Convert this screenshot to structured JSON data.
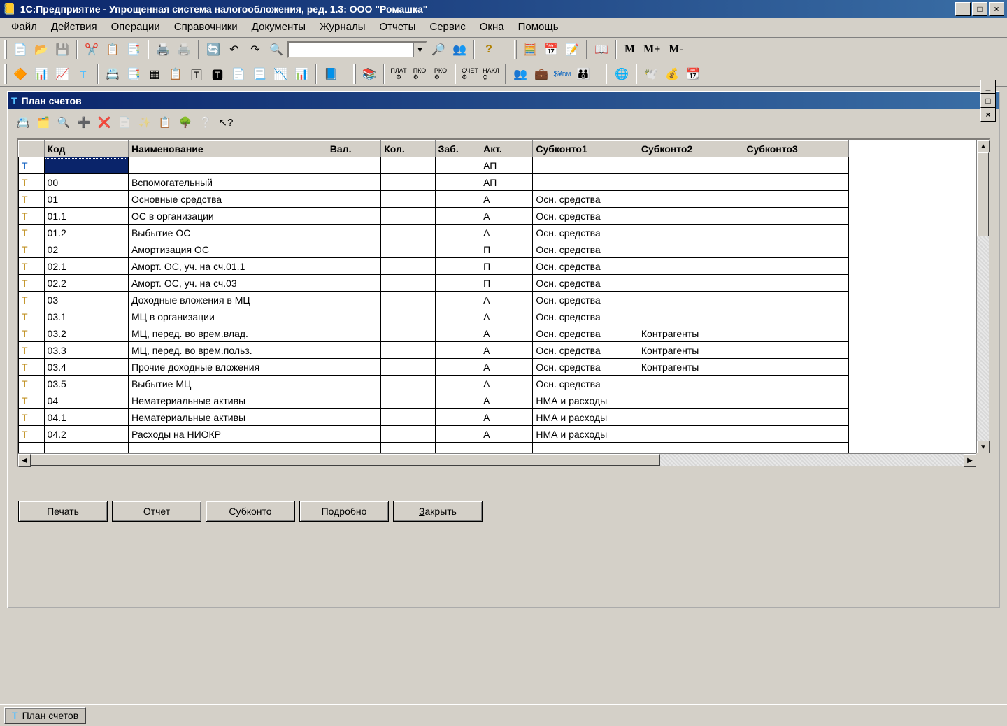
{
  "app": {
    "title": "1С:Предприятие - Упрощенная система налогообложения, ред. 1.3: ООО \"Ромашка\""
  },
  "menu": {
    "items": [
      "Файл",
      "Действия",
      "Операции",
      "Справочники",
      "Документы",
      "Журналы",
      "Отчеты",
      "Сервис",
      "Окна",
      "Помощь"
    ]
  },
  "toolbar1": {
    "search_value": "",
    "m": "M",
    "mplus": "M+",
    "mminus": "M-"
  },
  "inner": {
    "title": "План счетов",
    "buttons": {
      "print": "Печать",
      "report": "Отчет",
      "subkonto": "Субконто",
      "detail": "Подробно",
      "close_u": "З",
      "close_rest": "акрыть"
    }
  },
  "columns": {
    "icon": "",
    "code": "Код",
    "name": "Наименование",
    "val": "Вал.",
    "kol": "Кол.",
    "zab": "Заб.",
    "akt": "Акт.",
    "sub1": "Субконто1",
    "sub2": "Субконто2",
    "sub3": "Субконто3"
  },
  "rows": [
    {
      "icon": "blue",
      "code": "",
      "name": "",
      "val": "",
      "kol": "",
      "zab": "",
      "akt": "АП",
      "sub1": "",
      "sub2": "",
      "sub3": "",
      "selected": true
    },
    {
      "icon": "y",
      "code": "00",
      "name": "Вспомогательный",
      "val": "",
      "kol": "",
      "zab": "",
      "akt": "АП",
      "sub1": "",
      "sub2": "",
      "sub3": ""
    },
    {
      "icon": "y",
      "code": "01",
      "name": "Основные средства",
      "val": "",
      "kol": "",
      "zab": "",
      "akt": "А",
      "sub1": "Осн. средства",
      "sub2": "",
      "sub3": ""
    },
    {
      "icon": "y",
      "code": "01.1",
      "name": "ОС в организации",
      "val": "",
      "kol": "",
      "zab": "",
      "akt": "А",
      "sub1": "Осн. средства",
      "sub2": "",
      "sub3": ""
    },
    {
      "icon": "y",
      "code": "01.2",
      "name": "Выбытие ОС",
      "val": "",
      "kol": "",
      "zab": "",
      "akt": "А",
      "sub1": "Осн. средства",
      "sub2": "",
      "sub3": ""
    },
    {
      "icon": "y",
      "code": "02",
      "name": "Амортизация ОС",
      "val": "",
      "kol": "",
      "zab": "",
      "akt": "П",
      "sub1": "Осн. средства",
      "sub2": "",
      "sub3": ""
    },
    {
      "icon": "y",
      "code": "02.1",
      "name": "Аморт. ОС, уч. на сч.01.1",
      "val": "",
      "kol": "",
      "zab": "",
      "akt": "П",
      "sub1": "Осн. средства",
      "sub2": "",
      "sub3": ""
    },
    {
      "icon": "y",
      "code": "02.2",
      "name": "Аморт. ОС, уч. на сч.03",
      "val": "",
      "kol": "",
      "zab": "",
      "akt": "П",
      "sub1": "Осн. средства",
      "sub2": "",
      "sub3": ""
    },
    {
      "icon": "y",
      "code": "03",
      "name": "Доходные вложения в МЦ",
      "val": "",
      "kol": "",
      "zab": "",
      "akt": "А",
      "sub1": "Осн. средства",
      "sub2": "",
      "sub3": ""
    },
    {
      "icon": "y",
      "code": "03.1",
      "name": "МЦ в организации",
      "val": "",
      "kol": "",
      "zab": "",
      "akt": "А",
      "sub1": "Осн. средства",
      "sub2": "",
      "sub3": ""
    },
    {
      "icon": "y",
      "code": "03.2",
      "name": "МЦ, перед. во врем.влад.",
      "val": "",
      "kol": "",
      "zab": "",
      "akt": "А",
      "sub1": "Осн. средства",
      "sub2": "Контрагенты",
      "sub3": ""
    },
    {
      "icon": "y",
      "code": "03.3",
      "name": "МЦ, перед. во врем.польз.",
      "val": "",
      "kol": "",
      "zab": "",
      "akt": "А",
      "sub1": "Осн. средства",
      "sub2": "Контрагенты",
      "sub3": ""
    },
    {
      "icon": "y",
      "code": "03.4",
      "name": "Прочие доходные вложения",
      "val": "",
      "kol": "",
      "zab": "",
      "akt": "А",
      "sub1": "Осн. средства",
      "sub2": "Контрагенты",
      "sub3": ""
    },
    {
      "icon": "y",
      "code": "03.5",
      "name": "Выбытие МЦ",
      "val": "",
      "kol": "",
      "zab": "",
      "akt": "А",
      "sub1": "Осн. средства",
      "sub2": "",
      "sub3": ""
    },
    {
      "icon": "y",
      "code": "04",
      "name": "Нематериальные активы",
      "val": "",
      "kol": "",
      "zab": "",
      "akt": "А",
      "sub1": "НМА и расходы",
      "sub2": "",
      "sub3": ""
    },
    {
      "icon": "y",
      "code": "04.1",
      "name": "Нематериальные активы",
      "val": "",
      "kol": "",
      "zab": "",
      "akt": "А",
      "sub1": "НМА и расходы",
      "sub2": "",
      "sub3": ""
    },
    {
      "icon": "y",
      "code": "04.2",
      "name": "Расходы на НИОКР",
      "val": "",
      "kol": "",
      "zab": "",
      "akt": "А",
      "sub1": "НМА и расходы",
      "sub2": "",
      "sub3": ""
    }
  ],
  "taskbar": {
    "item": "План счетов"
  }
}
